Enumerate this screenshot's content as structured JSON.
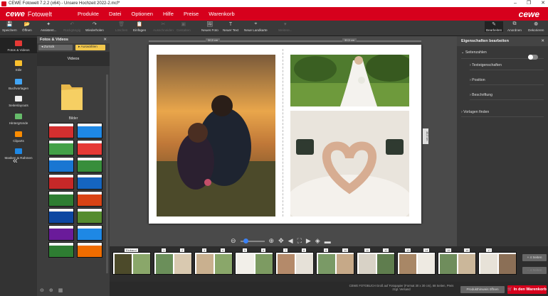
{
  "window": {
    "title": "CEWE Fotowelt 7.2.2 (x64) - Unsere Hochzeit 2022-2.mcf*",
    "controls": [
      "–",
      "❐",
      "✕"
    ]
  },
  "menubar": {
    "brand_a": "cewe",
    "brand_b": "Fotowelt",
    "items": [
      "Produkte",
      "Datei",
      "Optionen",
      "Hilfe",
      "Preise",
      "Warenkorb"
    ],
    "logo": "cewe"
  },
  "toolbar": {
    "buttons": [
      {
        "label": "Speichern",
        "icon": "save-icon",
        "enabled": true
      },
      {
        "label": "Öffnen",
        "icon": "open-icon",
        "enabled": true
      },
      {
        "label": "Assistent...",
        "icon": "wand-icon",
        "enabled": true
      },
      {
        "label": "Rückgängig",
        "icon": "undo-icon",
        "enabled": false
      },
      {
        "label": "Wiederholen",
        "icon": "redo-icon",
        "enabled": true
      },
      {
        "label": "Löschen",
        "icon": "delete-icon",
        "enabled": false
      },
      {
        "label": "Einfügen",
        "icon": "paste-icon",
        "enabled": true
      },
      {
        "label": "Ausschneiden",
        "icon": "cut-icon",
        "enabled": false
      },
      {
        "label": "Gestalten",
        "icon": "design-icon",
        "enabled": false
      },
      {
        "label": "Neues Foto",
        "icon": "photo-icon",
        "enabled": true
      },
      {
        "label": "Neuer Text",
        "icon": "text-icon",
        "enabled": true
      },
      {
        "label": "Neue Landkarte",
        "icon": "map-icon",
        "enabled": true
      },
      {
        "label": "Weitere...",
        "icon": "more-icon",
        "enabled": false
      }
    ],
    "right": [
      {
        "label": "Bearbeiten",
        "icon": "edit-icon",
        "active": true
      },
      {
        "label": "Anordnen",
        "icon": "arrange-icon",
        "active": false
      },
      {
        "label": "Dekorieren",
        "icon": "decorate-icon",
        "active": false
      }
    ]
  },
  "rail": [
    {
      "label": "Fotos & Videos",
      "color": "#e53935",
      "active": true
    },
    {
      "label": "Stile",
      "color": "#fbc02d",
      "active": false
    },
    {
      "label": "Buchvorlagen",
      "color": "#42a5f5",
      "active": false
    },
    {
      "label": "Seitenlayouts",
      "color": "#eeeeee",
      "active": false
    },
    {
      "label": "Hintergründe",
      "color": "#66bb6a",
      "active": false
    },
    {
      "label": "Cliparts",
      "color": "#fb8c00",
      "active": false
    },
    {
      "label": "Masken & Rahmen",
      "color": "#1e88e5",
      "active": false
    }
  ],
  "rail_collapse": "«",
  "panel": {
    "title": "Fotos & Videos",
    "back": "Zurück",
    "filter": "Auswählen",
    "tab": "Videos",
    "folder_label": "Bilder",
    "thumb_colors": [
      "#d32f2f",
      "#1e88e5",
      "#43a047",
      "#e53935",
      "#1976d2",
      "#388e3c",
      "#c62828",
      "#1565c0",
      "#2e7d32",
      "#d84315",
      "#0d47a1",
      "#558b2f",
      "#6a1b9a",
      "#1e88e5",
      "#2e7d32",
      "#ef6c00"
    ]
  },
  "canvas": {
    "size_left": "30,5 cm",
    "size_right": "30,5 cm",
    "side_label": "30,0 cm"
  },
  "zoom": {
    "minus": "⊖",
    "plus": "⊕"
  },
  "properties": {
    "title": "Eigenschaften bearbeiten",
    "section": "Seitenzahlen",
    "rows": [
      "Texteigenschaften",
      "Position",
      "Beschriftung"
    ],
    "templates": "Vorlagen finden"
  },
  "strip": {
    "cover": "Einband",
    "pages": [
      "1",
      "2",
      "3",
      "4",
      "5",
      "6",
      "7",
      "8",
      "9",
      "10",
      "11",
      "12",
      "13",
      "14",
      "15",
      "16",
      "17"
    ]
  },
  "status": {
    "text": "CEWE FOTOBUCH Groß auf Fotopapier (Format 30 x 30 cm), 68 Seiten, Preis zzgl. Versand",
    "warn_button": "Produkthinweis öffnen",
    "cart": "In den Warenkorb",
    "side_a": "+ 4 Seiten",
    "side_b": "− 4 Seiten"
  }
}
